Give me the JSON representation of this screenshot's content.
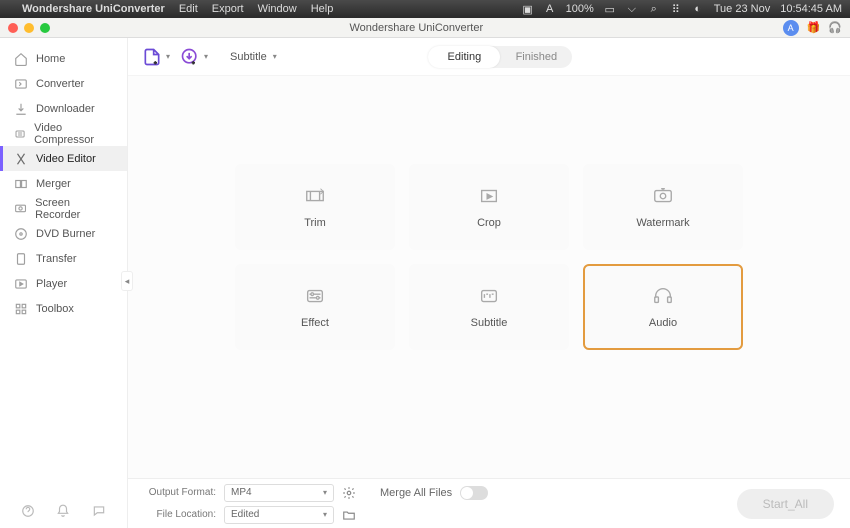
{
  "menubar": {
    "apple": "",
    "appname": "Wondershare UniConverter",
    "items": [
      "Edit",
      "Export",
      "Window",
      "Help"
    ],
    "battery": "100%",
    "date": "Tue 23 Nov",
    "time": "10:54:45 AM"
  },
  "titlebar": {
    "title": "Wondershare UniConverter",
    "avatar": "A"
  },
  "sidebar": {
    "items": [
      {
        "label": "Home",
        "icon": "home-icon"
      },
      {
        "label": "Converter",
        "icon": "converter-icon"
      },
      {
        "label": "Downloader",
        "icon": "download-icon"
      },
      {
        "label": "Video Compressor",
        "icon": "compress-icon"
      },
      {
        "label": "Video Editor",
        "icon": "editor-icon",
        "active": true
      },
      {
        "label": "Merger",
        "icon": "merger-icon"
      },
      {
        "label": "Screen Recorder",
        "icon": "recorder-icon"
      },
      {
        "label": "DVD Burner",
        "icon": "dvd-icon"
      },
      {
        "label": "Transfer",
        "icon": "transfer-icon"
      },
      {
        "label": "Player",
        "icon": "player-icon"
      },
      {
        "label": "Toolbox",
        "icon": "toolbox-icon"
      }
    ]
  },
  "toolbar": {
    "subtitle_label": "Subtitle",
    "segment": {
      "editing": "Editing",
      "finished": "Finished",
      "active": "editing"
    }
  },
  "tiles": [
    {
      "label": "Trim",
      "icon": "trim-icon"
    },
    {
      "label": "Crop",
      "icon": "crop-icon"
    },
    {
      "label": "Watermark",
      "icon": "watermark-icon"
    },
    {
      "label": "Effect",
      "icon": "effect-icon"
    },
    {
      "label": "Subtitle",
      "icon": "subtitle-icon"
    },
    {
      "label": "Audio",
      "icon": "audio-icon",
      "highlight": true
    }
  ],
  "footer": {
    "output_format_label": "Output Format:",
    "output_format_value": "MP4",
    "file_location_label": "File Location:",
    "file_location_value": "Edited",
    "merge_label": "Merge All Files",
    "start_label": "Start_All"
  }
}
